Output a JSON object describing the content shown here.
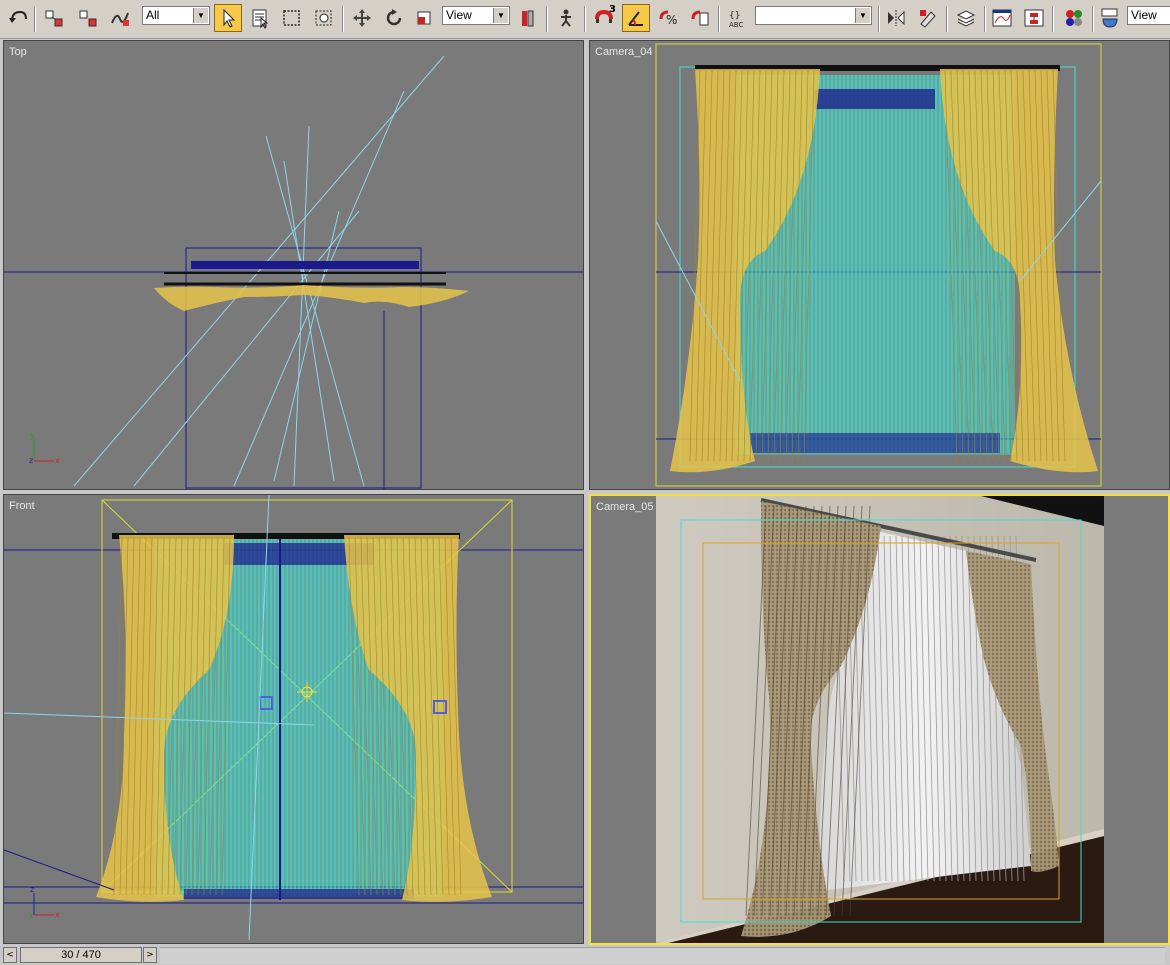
{
  "toolbar": {
    "selection_filter": "All",
    "reference_coord": "View",
    "snap_angle_badge": "3",
    "named_selection": "",
    "render_view": "View",
    "icons": [
      "undo-icon",
      "select-link-icon",
      "unlink-icon",
      "bind-spacewarp-icon",
      "select-object-icon",
      "select-by-name-icon",
      "rect-region-icon",
      "window-crossing-icon",
      "move-icon",
      "rotate-icon",
      "scale-icon",
      "pivot-icon",
      "manipulate-icon",
      "snap-icon",
      "angle-snap-icon",
      "percent-snap-icon",
      "spinner-snap-icon",
      "edit-named-sel-icon",
      "mirror-icon",
      "align-icon",
      "layer-icon",
      "curve-editor-icon",
      "schematic-icon",
      "material-editor-icon",
      "render-setup-icon"
    ]
  },
  "viewports": {
    "top": {
      "label": "Top"
    },
    "camera04": {
      "label": "Camera_04"
    },
    "front": {
      "label": "Front"
    },
    "camera05": {
      "label": "Camera_05"
    }
  },
  "timeslider": {
    "frame": "30 / 470",
    "prev": "<",
    "next": ">"
  },
  "colors": {
    "viewport_bg": "#7a7a7a",
    "curtain_wire": "#e8c44a",
    "sheer_wire": "#40e0d0",
    "blueprint": "#1a1a8c",
    "active_border": "#f5e23a"
  }
}
